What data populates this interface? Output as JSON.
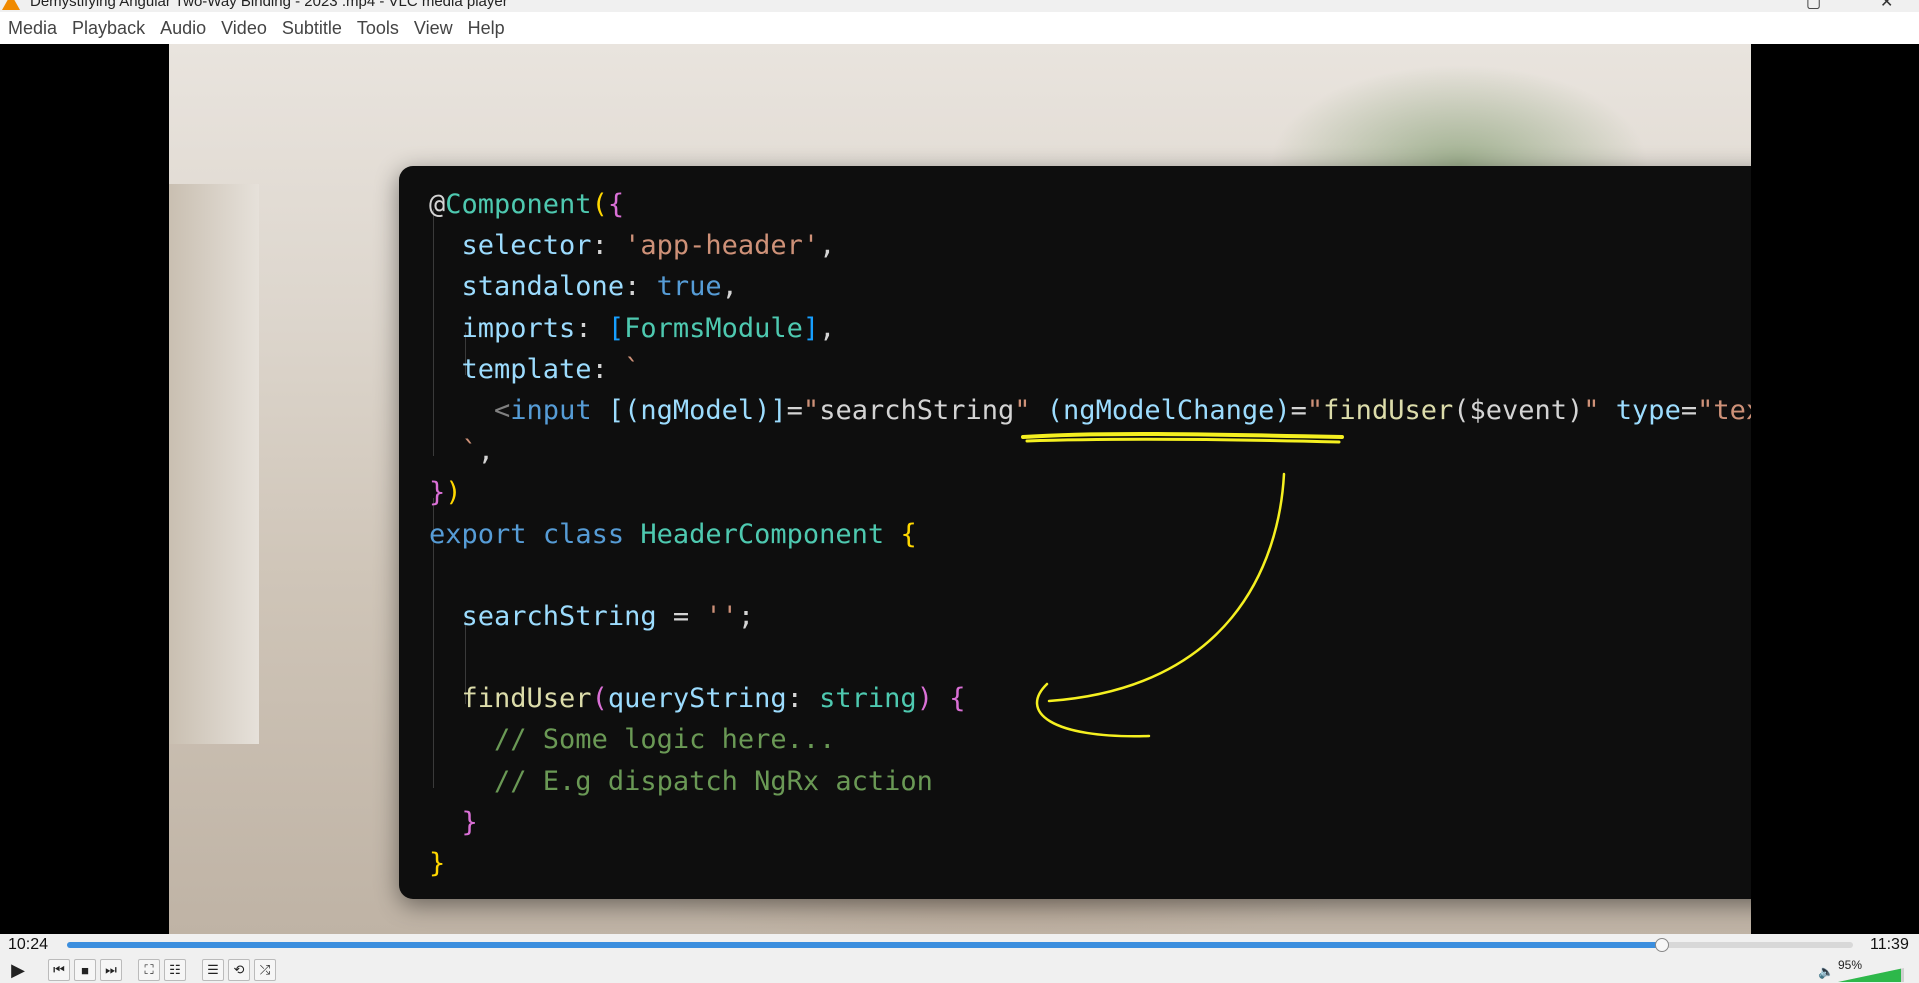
{
  "window": {
    "title": "Demystifying Angular Two-Way Binding - 2023 .mp4 - VLC media player"
  },
  "menu": [
    "Media",
    "Playback",
    "Audio",
    "Video",
    "Subtitle",
    "Tools",
    "View",
    "Help"
  ],
  "code_lines": [
    [
      [
        "t-plain",
        "@"
      ],
      [
        "t-type",
        "Component"
      ],
      [
        "t-bracket2",
        "("
      ],
      [
        "t-bracket1",
        "{"
      ]
    ],
    [
      [
        "t-plain",
        "  "
      ],
      [
        "t-key",
        "selector"
      ],
      [
        "t-plain",
        ": "
      ],
      [
        "t-str",
        "'app-header'"
      ],
      [
        "t-plain",
        ","
      ]
    ],
    [
      [
        "t-plain",
        "  "
      ],
      [
        "t-key",
        "standalone"
      ],
      [
        "t-plain",
        ": "
      ],
      [
        "t-kw",
        "true"
      ],
      [
        "t-plain",
        ","
      ]
    ],
    [
      [
        "t-plain",
        "  "
      ],
      [
        "t-key",
        "imports"
      ],
      [
        "t-plain",
        ": "
      ],
      [
        "t-bracket3",
        "["
      ],
      [
        "t-type",
        "FormsModule"
      ],
      [
        "t-bracket3",
        "]"
      ],
      [
        "t-plain",
        ","
      ]
    ],
    [
      [
        "t-plain",
        "  "
      ],
      [
        "t-key",
        "template"
      ],
      [
        "t-plain",
        ": "
      ],
      [
        "t-str",
        "`"
      ]
    ],
    [
      [
        "t-plain",
        "    "
      ],
      [
        "t-tag",
        "<"
      ],
      [
        "t-tagname",
        "input"
      ],
      [
        "t-plain",
        " "
      ],
      [
        "t-attr",
        "[(ngModel)]"
      ],
      [
        "t-plain",
        "="
      ],
      [
        "t-str",
        "\""
      ],
      [
        "t-plain",
        "searchString"
      ],
      [
        "t-str",
        "\""
      ],
      [
        "t-plain",
        " "
      ],
      [
        "t-attr",
        "(ngModelChange)"
      ],
      [
        "t-plain",
        "="
      ],
      [
        "t-str",
        "\""
      ],
      [
        "t-fn",
        "findUser"
      ],
      [
        "t-plain",
        "($event)"
      ],
      [
        "t-str",
        "\""
      ],
      [
        "t-plain",
        " "
      ],
      [
        "t-attr",
        "type"
      ],
      [
        "t-plain",
        "="
      ],
      [
        "t-str",
        "\"text\""
      ],
      [
        "t-tag",
        ">"
      ]
    ],
    [
      [
        "t-plain",
        "  "
      ],
      [
        "t-str",
        "`"
      ],
      [
        "t-plain",
        ","
      ]
    ],
    [
      [
        "t-bracket1",
        "}"
      ],
      [
        "t-bracket2",
        ")"
      ]
    ],
    [
      [
        "t-kw",
        "export"
      ],
      [
        "t-plain",
        " "
      ],
      [
        "t-kw",
        "class"
      ],
      [
        "t-plain",
        " "
      ],
      [
        "t-type",
        "HeaderComponent"
      ],
      [
        "t-plain",
        " "
      ],
      [
        "t-bracket2",
        "{"
      ]
    ],
    [
      [
        "t-plain",
        " "
      ]
    ],
    [
      [
        "t-plain",
        "  "
      ],
      [
        "t-key",
        "searchString"
      ],
      [
        "t-plain",
        " = "
      ],
      [
        "t-str",
        "''"
      ],
      [
        "t-plain",
        ";"
      ]
    ],
    [
      [
        "t-plain",
        " "
      ]
    ],
    [
      [
        "t-plain",
        "  "
      ],
      [
        "t-fn",
        "findUser"
      ],
      [
        "t-bracket1",
        "("
      ],
      [
        "t-key",
        "queryString"
      ],
      [
        "t-plain",
        ": "
      ],
      [
        "t-type",
        "string"
      ],
      [
        "t-bracket1",
        ")"
      ],
      [
        "t-plain",
        " "
      ],
      [
        "t-bracket1",
        "{"
      ]
    ],
    [
      [
        "t-plain",
        "    "
      ],
      [
        "t-comment",
        "// Some logic here..."
      ]
    ],
    [
      [
        "t-plain",
        "    "
      ],
      [
        "t-comment",
        "// E.g dispatch NgRx action"
      ]
    ],
    [
      [
        "t-plain",
        "  "
      ],
      [
        "t-bracket1",
        "}"
      ]
    ],
    [
      [
        "t-bracket2",
        "}"
      ]
    ]
  ],
  "player": {
    "elapsed": "10:24",
    "total": "11:39",
    "progress": 0.893,
    "volume_label": "95%",
    "volume": 0.95
  },
  "colors": {
    "accent": "#3b8ede",
    "annotation": "#f5f020",
    "volume_fill": "#2db84a"
  }
}
